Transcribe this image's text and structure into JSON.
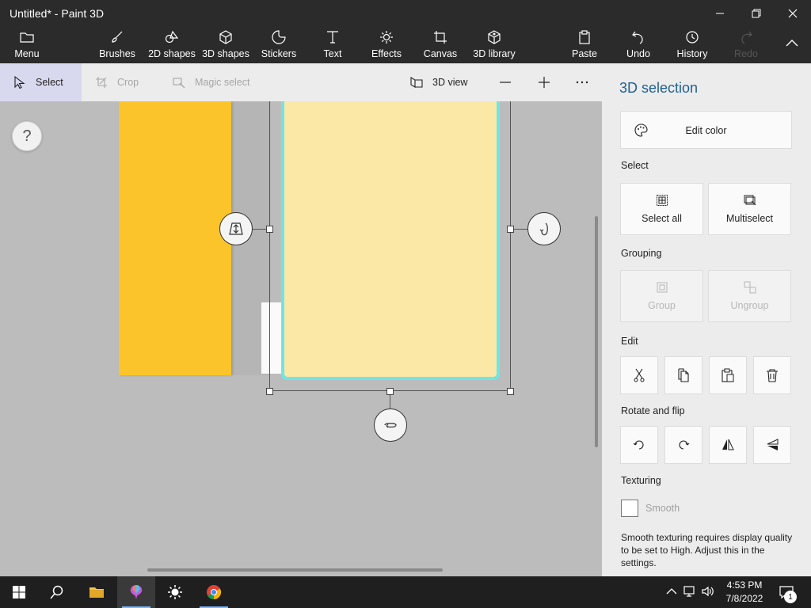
{
  "window": {
    "title": "Untitled* - Paint 3D"
  },
  "ribbon": {
    "menu": "Menu",
    "brushes": "Brushes",
    "shapes2d": "2D shapes",
    "shapes3d": "3D shapes",
    "stickers": "Stickers",
    "text": "Text",
    "effects": "Effects",
    "canvas": "Canvas",
    "library3d": "3D library",
    "paste": "Paste",
    "undo": "Undo",
    "history": "History",
    "redo": "Redo"
  },
  "subbar": {
    "select": "Select",
    "crop": "Crop",
    "magic_select": "Magic select",
    "view3d": "3D view"
  },
  "canvas": {
    "help": "?"
  },
  "panel": {
    "title": "3D selection",
    "edit_color": "Edit color",
    "select_section": "Select",
    "select_all": "Select all",
    "multiselect": "Multiselect",
    "grouping_section": "Grouping",
    "group": "Group",
    "ungroup": "Ungroup",
    "edit_section": "Edit",
    "rotate_section": "Rotate and flip",
    "texturing_section": "Texturing",
    "smooth": "Smooth",
    "smooth_checked": false,
    "note": "Smooth texturing requires display quality to be set to High. Adjust this in the settings."
  },
  "taskbar": {
    "time": "4:53 PM",
    "date": "7/8/2022",
    "notifications": "1"
  },
  "colors": {
    "accent": "#1e5f96",
    "selection_outline": "#6ee6e6",
    "orange_object": "#fcc42b",
    "cream_object": "#fbe7a6"
  }
}
